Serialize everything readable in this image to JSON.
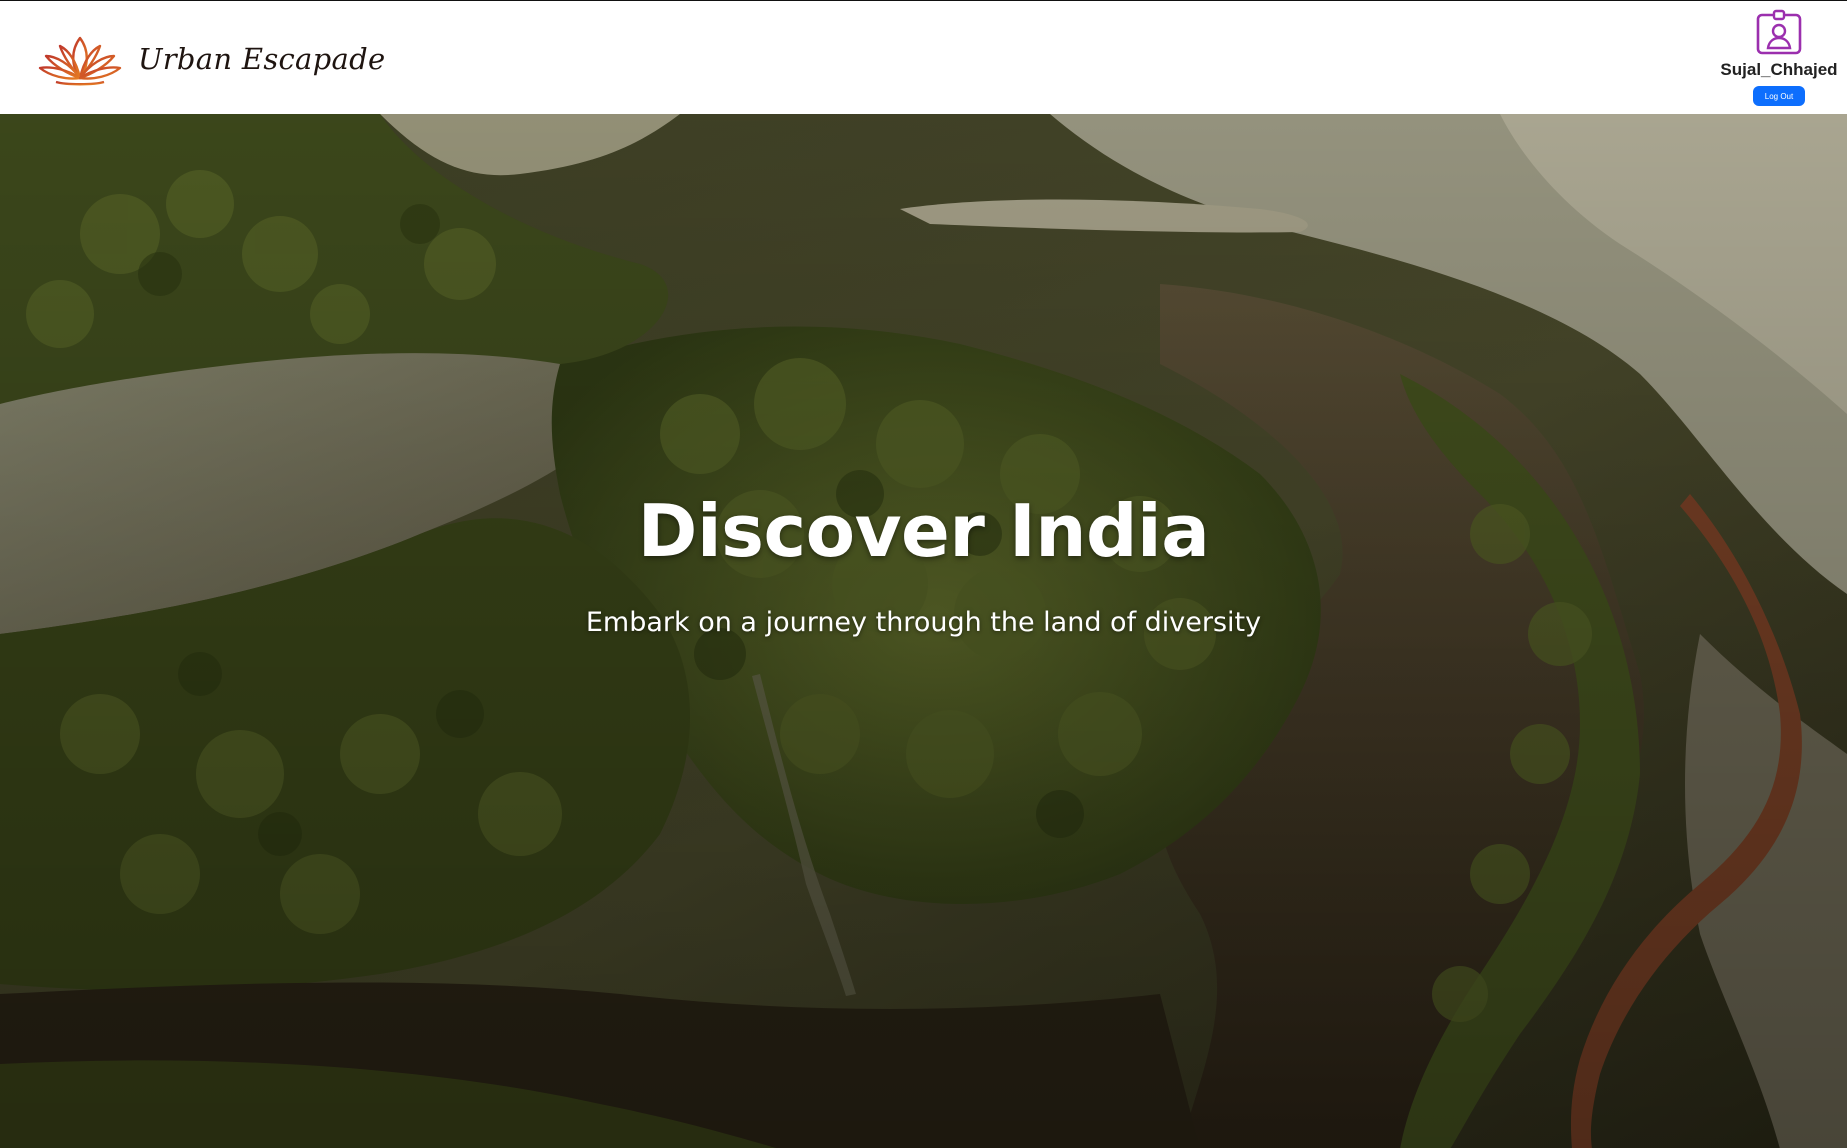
{
  "header": {
    "brand_name": "Urban Escapade",
    "logo_icon": "lotus-icon",
    "user": {
      "avatar_icon": "user-badge-icon",
      "username": "Sujal_Chhajed",
      "logout_label": "Log Out"
    }
  },
  "hero": {
    "title": "Discover India",
    "subtitle": "Embark on a journey through the land of diversity",
    "background": "aerial-mangrove-landscape"
  },
  "colors": {
    "logo_gradient_start": "#c0392b",
    "logo_gradient_end": "#e67e22",
    "avatar_accent": "#9b2fae",
    "logout_button": "#0d6efd"
  }
}
